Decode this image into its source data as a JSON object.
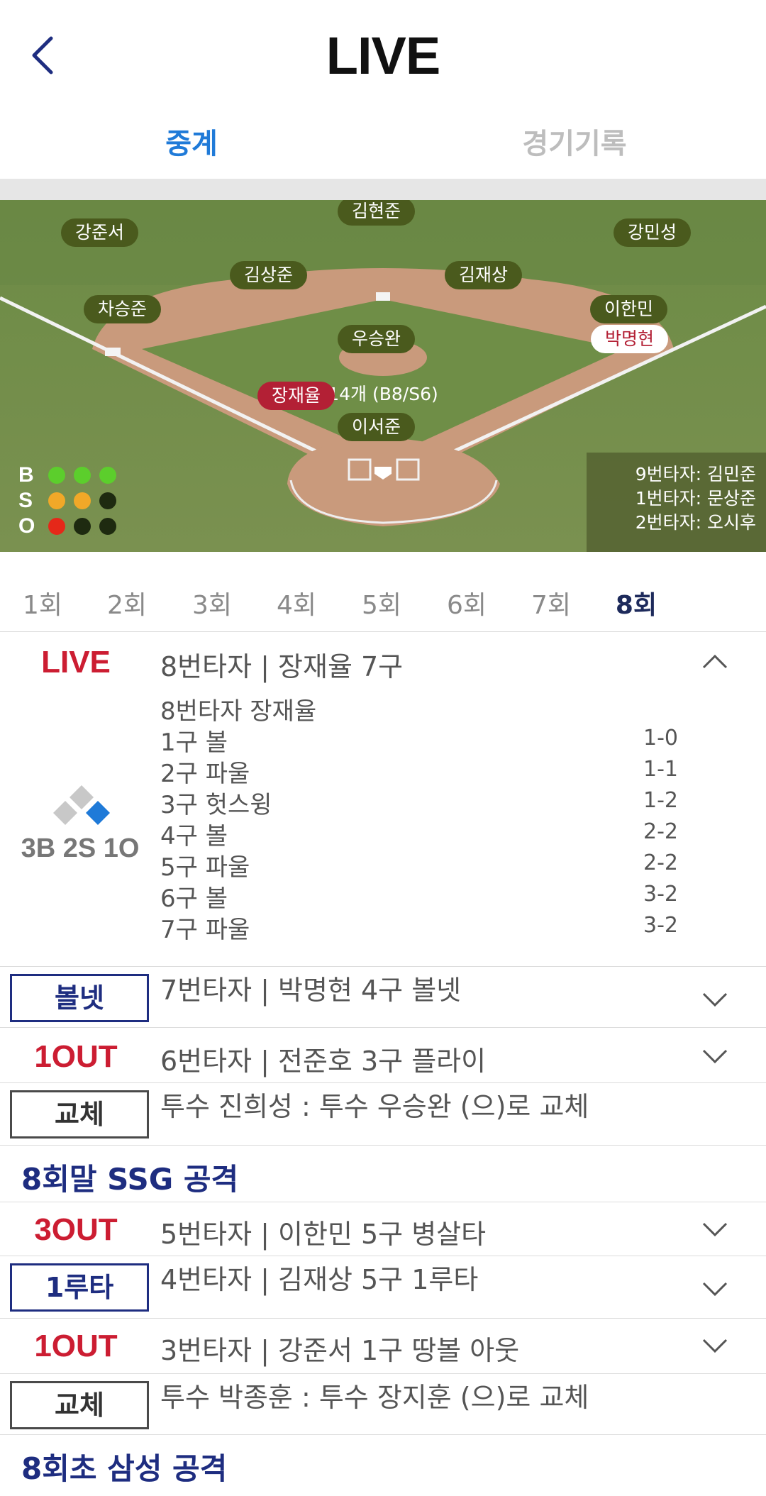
{
  "header": {
    "title": "LIVE",
    "back_icon": "chevron-left-icon"
  },
  "tabs": [
    {
      "label": "중계",
      "active": true
    },
    {
      "label": "경기기록",
      "active": false
    }
  ],
  "field": {
    "players": {
      "cf": "김현준",
      "lf": "강준서",
      "rf": "강민성",
      "ss": "김상준",
      "second": "김재상",
      "third": "차승준",
      "first": "이한민",
      "pitcher": "우승완",
      "catcher": "이서준",
      "batter": "장재율",
      "runner": "박명현"
    },
    "pitch_count": "14개 (B8/S6)",
    "bso": {
      "labels": [
        "B",
        "S",
        "O"
      ],
      "balls": 3,
      "strikes": 2,
      "outs": 1,
      "colors": {
        "ball": "#5cce2c",
        "strike": "#f1a828",
        "out": "#e52819"
      }
    },
    "up_next": [
      "9번타자: 김민준",
      "1번타자: 문상준",
      "2번타자: 오시후"
    ]
  },
  "innings": [
    "1회",
    "2회",
    "3회",
    "4회",
    "5회",
    "6회",
    "7회",
    "8회"
  ],
  "active_inning": "8회",
  "live": {
    "label": "LIVE",
    "summary": "8번타자 | 장재율 7구",
    "count": "3B 2S 1O",
    "batter_line": "8번타자 장재율",
    "pitches": [
      {
        "desc": "1구 볼",
        "count": "1-0"
      },
      {
        "desc": "2구 파울",
        "count": "1-1"
      },
      {
        "desc": "3구 헛스윙",
        "count": "1-2"
      },
      {
        "desc": "4구 볼",
        "count": "2-2"
      },
      {
        "desc": "5구 파울",
        "count": "2-2"
      },
      {
        "desc": "6구 볼",
        "count": "3-2"
      },
      {
        "desc": "7구 파울",
        "count": "3-2"
      }
    ]
  },
  "events": [
    {
      "label": "볼넷",
      "desc": "7번타자 | 박명현 4구 볼넷"
    },
    {
      "label": "1OUT",
      "desc": "6번타자 | 전준호 3구 플라이"
    },
    {
      "label": "교체",
      "desc": "투수 진희성 : 투수 우승완 (으)로 교체"
    },
    {
      "section": "8회말 SSG 공격"
    },
    {
      "label": "3OUT",
      "desc": "5번타자 | 이한민 5구 병살타"
    },
    {
      "label": "1루타",
      "desc": "4번타자 | 김재상 5구 1루타"
    },
    {
      "label": "1OUT",
      "desc": "3번타자 | 강준서 1구 땅볼 아웃"
    },
    {
      "label": "교체",
      "desc": "투수 박종훈 : 투수 장지훈 (으)로 교체"
    },
    {
      "section": "8회초 삼성 공격"
    }
  ],
  "colors": {
    "accent_blue": "#1f7ad8",
    "navy": "#1e2d80",
    "red": "#cc1d32"
  }
}
